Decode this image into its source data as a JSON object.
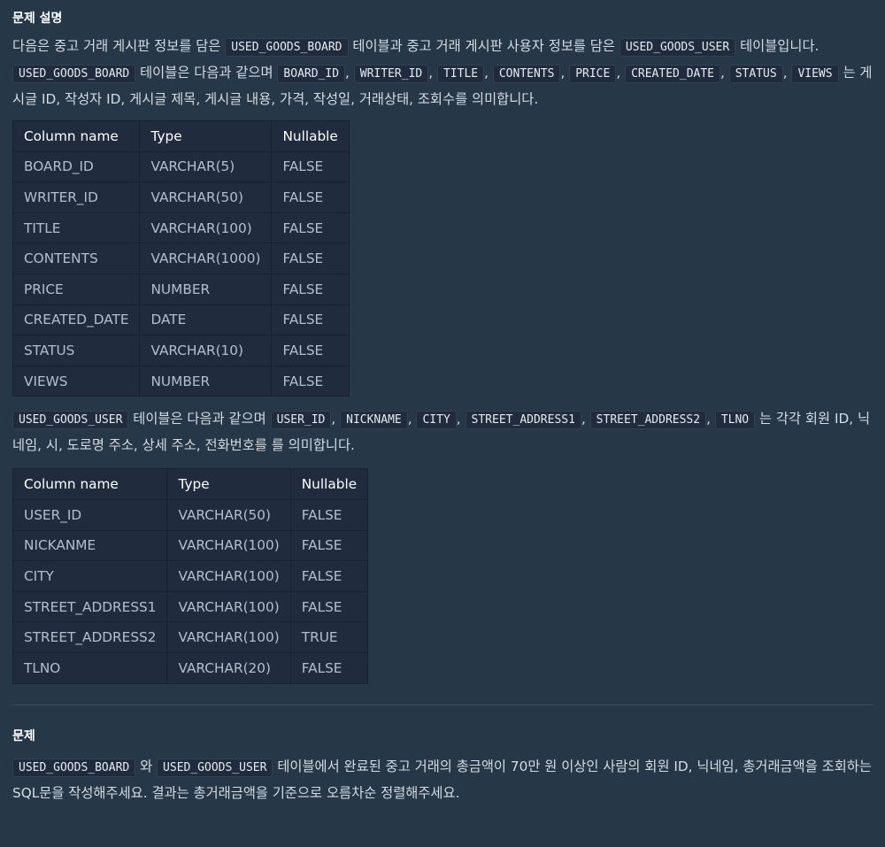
{
  "description_heading": "문제 설명",
  "intro": {
    "t1": "다음은 중고 거래 게시판 정보를 담은 ",
    "c1": "USED_GOODS_BOARD",
    "t2": " 테이블과 중고 거래 게시판 사용자 정보를 담은 ",
    "c2": "USED_GOODS_USER",
    "t3": " 테이블입니다. "
  },
  "board_desc": {
    "table": "USED_GOODS_BOARD",
    "t1": " 테이블은 다음과 같으며 ",
    "columns": [
      "BOARD_ID",
      "WRITER_ID",
      "TITLE",
      "CONTENTS",
      "PRICE",
      "CREATED_DATE",
      "STATUS",
      "VIEWS"
    ],
    "sep": ", ",
    "t2": " 는 게시글 ID, 작성자 ID, 게시글 제목, 게시글 내용, 가격, 작성일, 거래상태, 조회수를 의미합니다."
  },
  "board_table": {
    "headers": [
      "Column name",
      "Type",
      "Nullable"
    ],
    "rows": [
      [
        "BOARD_ID",
        "VARCHAR(5)",
        "FALSE"
      ],
      [
        "WRITER_ID",
        "VARCHAR(50)",
        "FALSE"
      ],
      [
        "TITLE",
        "VARCHAR(100)",
        "FALSE"
      ],
      [
        "CONTENTS",
        "VARCHAR(1000)",
        "FALSE"
      ],
      [
        "PRICE",
        "NUMBER",
        "FALSE"
      ],
      [
        "CREATED_DATE",
        "DATE",
        "FALSE"
      ],
      [
        "STATUS",
        "VARCHAR(10)",
        "FALSE"
      ],
      [
        "VIEWS",
        "NUMBER",
        "FALSE"
      ]
    ]
  },
  "user_desc": {
    "table": "USED_GOODS_USER",
    "t1": " 테이블은 다음과 같으며 ",
    "columns": [
      "USER_ID",
      "NICKNAME",
      "CITY",
      "STREET_ADDRESS1",
      "STREET_ADDRESS2",
      "TLNO"
    ],
    "sep": ", ",
    "t2": " 는 각각 회원 ID, 닉네임, 시, 도로명 주소, 상세 주소, 전화번호를 를 의미합니다."
  },
  "user_table": {
    "headers": [
      "Column name",
      "Type",
      "Nullable"
    ],
    "rows": [
      [
        "USER_ID",
        "VARCHAR(50)",
        "FALSE"
      ],
      [
        "NICKANME",
        "VARCHAR(100)",
        "FALSE"
      ],
      [
        "CITY",
        "VARCHAR(100)",
        "FALSE"
      ],
      [
        "STREET_ADDRESS1",
        "VARCHAR(100)",
        "FALSE"
      ],
      [
        "STREET_ADDRESS2",
        "VARCHAR(100)",
        "TRUE"
      ],
      [
        "TLNO",
        "VARCHAR(20)",
        "FALSE"
      ]
    ]
  },
  "problem_heading": "문제",
  "problem": {
    "c1": "USED_GOODS_BOARD",
    "t1": " 와 ",
    "c2": "USED_GOODS_USER",
    "t2": " 테이블에서 완료된 중고 거래의 총금액이 70만 원 이상인 사람의 회원 ID, 닉네임, 총거래금액을 조회하는 SQL문을 작성해주세요. 결과는 총거래금액을 기준으로 오름차순 정렬해주세요."
  }
}
